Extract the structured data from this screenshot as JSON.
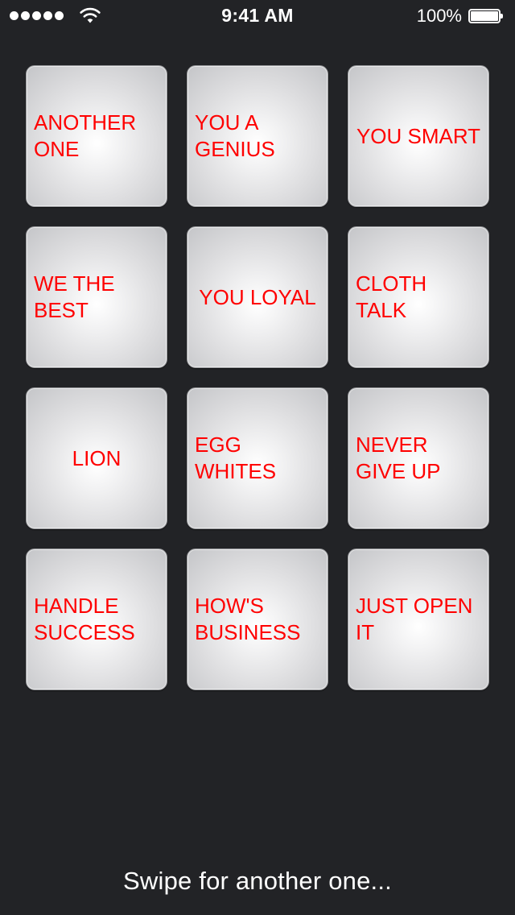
{
  "status_bar": {
    "time": "9:41 AM",
    "battery_percent": "100%",
    "signal_bars": 5,
    "battery_level": 1.0
  },
  "tiles": [
    {
      "label": "ANOTHER ONE"
    },
    {
      "label": "YOU A GENIUS"
    },
    {
      "label": "YOU SMART"
    },
    {
      "label": "WE THE BEST"
    },
    {
      "label": "YOU LOYAL"
    },
    {
      "label": "CLOTH TALK"
    },
    {
      "label": "LION"
    },
    {
      "label": "EGG WHITES"
    },
    {
      "label": "NEVER GIVE UP"
    },
    {
      "label": "HANDLE SUCCESS"
    },
    {
      "label": "HOW'S BUSINESS"
    },
    {
      "label": "JUST OPEN IT"
    }
  ],
  "footer": {
    "hint": "Swipe for another one..."
  },
  "colors": {
    "background": "#222326",
    "tile_text": "#ff0000",
    "status_text": "#ffffff"
  }
}
